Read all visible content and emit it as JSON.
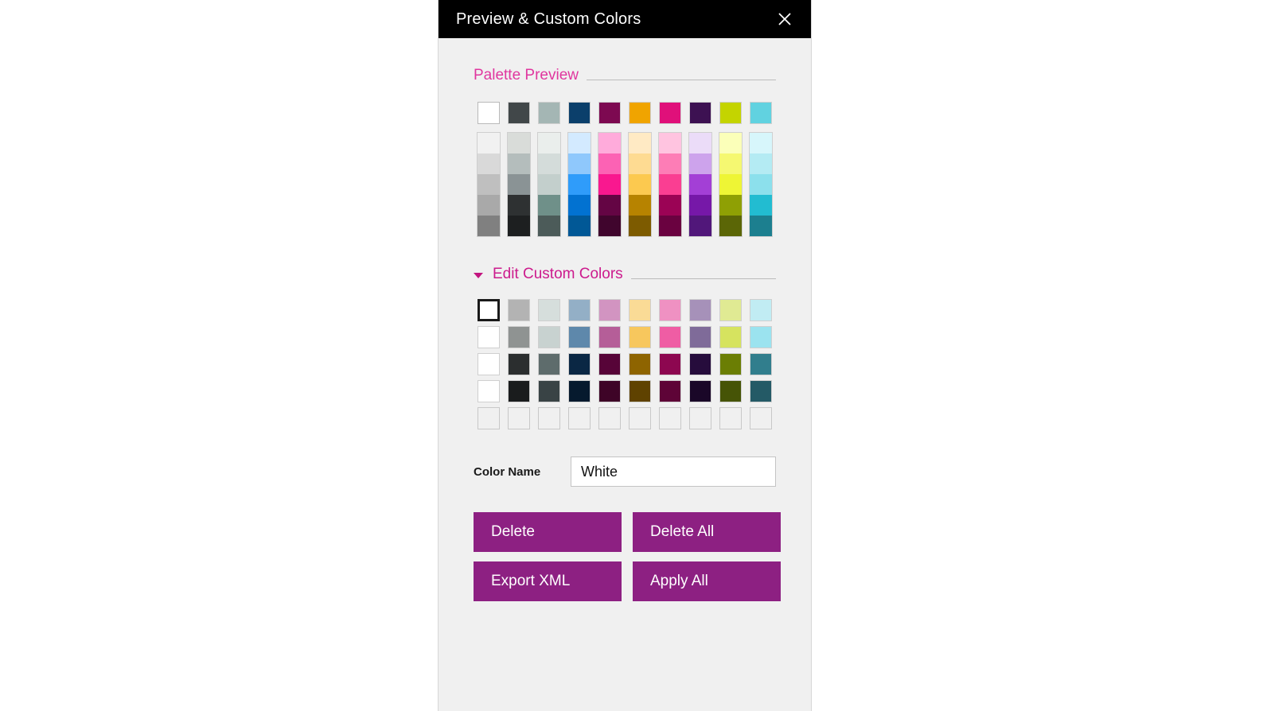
{
  "window": {
    "title": "Preview & Custom Colors",
    "close_icon": "close-icon"
  },
  "sections": {
    "palette_preview": {
      "title": "Palette Preview"
    },
    "edit_custom_colors": {
      "title": "Edit Custom Colors",
      "caret_icon": "chevron-down-icon"
    }
  },
  "theme": {
    "accent_magenta": "#e0369f",
    "accent_magenta_dark": "#cc1b8d",
    "button_purple": "#8d2082",
    "panel_bg": "#f0f0f0",
    "titlebar_bg": "#000000"
  },
  "palette_preview": {
    "base_colors": [
      "#ffffff",
      "#414749",
      "#a4b6b4",
      "#0b3f6b",
      "#7d0951",
      "#f0a400",
      "#e0107a",
      "#3d1152",
      "#c4d400",
      "#61d2e0"
    ],
    "gradient_columns": [
      [
        "#f1f1f1",
        "#d9d9d9",
        "#bfbfbf",
        "#a9a9a9",
        "#808080"
      ],
      [
        "#d9dcd9",
        "#b4bdbc",
        "#8a9395",
        "#2e3132",
        "#1d1f20"
      ],
      [
        "#eaeeec",
        "#d4dcda",
        "#c3cfcc",
        "#6f9089",
        "#4c5b59"
      ],
      [
        "#d3eaff",
        "#8fc8fc",
        "#2f9cfa",
        "#0272d1",
        "#015896"
      ],
      [
        "#ffabdb",
        "#fc62b4",
        "#f9188f",
        "#640544",
        "#40052d"
      ],
      [
        "#ffeac4",
        "#fedb92",
        "#fcc94f",
        "#b78300",
        "#7d5b00"
      ],
      [
        "#ffc4e0",
        "#fd7db6",
        "#fa3e92",
        "#9b0355",
        "#6a0240"
      ],
      [
        "#ebdcf8",
        "#cda3ec",
        "#a33fd6",
        "#7618a8",
        "#51177a"
      ],
      [
        "#fbffb9",
        "#f5f871",
        "#eef535",
        "#8fa004",
        "#5b6606"
      ],
      [
        "#d7f6fb",
        "#b4ebf3",
        "#8ce0ec",
        "#22bcd1",
        "#1c7f8f"
      ]
    ]
  },
  "custom_colors": {
    "selected_index": 0,
    "rows": [
      [
        "#ffffff",
        "#b3b3b3",
        "#d6dedc",
        "#93afc6",
        "#d294c1",
        "#fadb96",
        "#ef91c2",
        "#a691b9",
        "#e0ea93",
        "#c1ecf3"
      ],
      [
        "#ffffff",
        "#8f9392",
        "#c8d2d0",
        "#5e88ab",
        "#b55e98",
        "#f7c75d",
        "#ef5da4",
        "#7f6b99",
        "#d6e35f",
        "#9be3ef"
      ],
      [
        "#ffffff",
        "#2b2e2f",
        "#5e6c6c",
        "#0a2744",
        "#570438",
        "#8e6400",
        "#8d0750",
        "#260c3c",
        "#6b7e04",
        "#317e8d"
      ],
      [
        "#ffffff",
        "#1a1c1d",
        "#394345",
        "#061a2e",
        "#3e0427",
        "#5f4200",
        "#5e0437",
        "#1a0728",
        "#465406",
        "#245a66"
      ],
      [
        "empty",
        "empty",
        "empty",
        "empty",
        "empty",
        "empty",
        "empty",
        "empty",
        "empty",
        "empty"
      ]
    ]
  },
  "color_name": {
    "label": "Color Name",
    "value": "White",
    "placeholder": "Color Name"
  },
  "buttons": {
    "delete": "Delete",
    "delete_all": "Delete All",
    "export_xml": "Export XML",
    "apply_all": "Apply All"
  }
}
